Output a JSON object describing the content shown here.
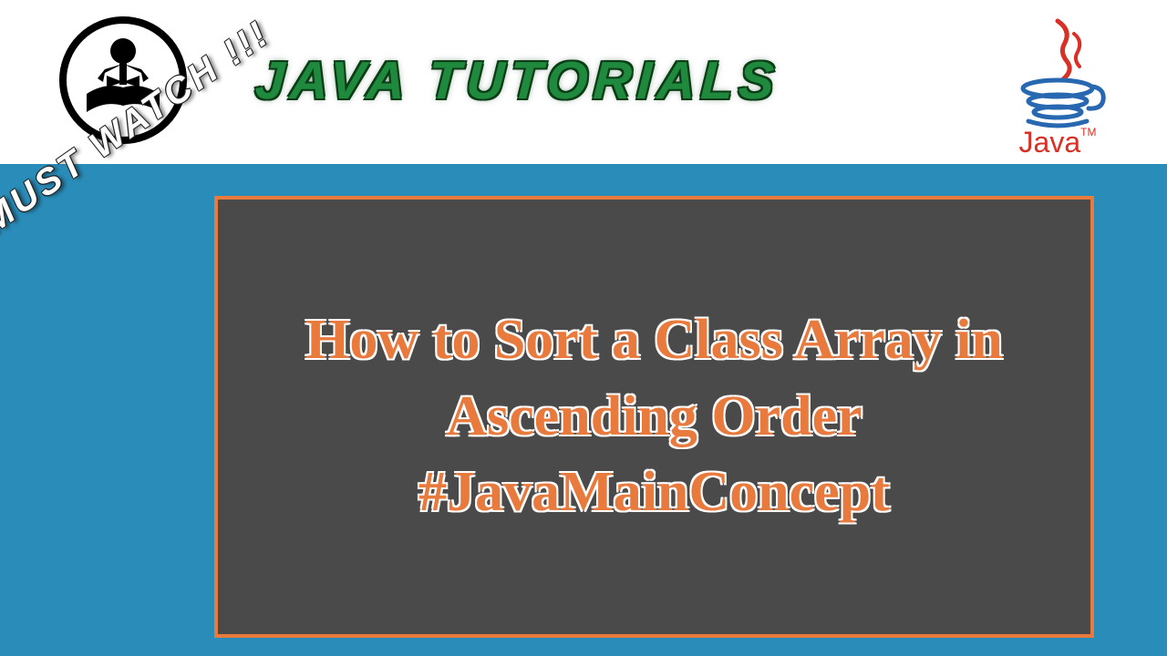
{
  "header": {
    "title": "JAVA TUTORIALS",
    "logo_text": "Java",
    "trademark": "TM"
  },
  "badge": {
    "text": "MUST WATCH !!!"
  },
  "content": {
    "title": "How to Sort a Class Array in Ascending Order #JavaMainConcept"
  }
}
